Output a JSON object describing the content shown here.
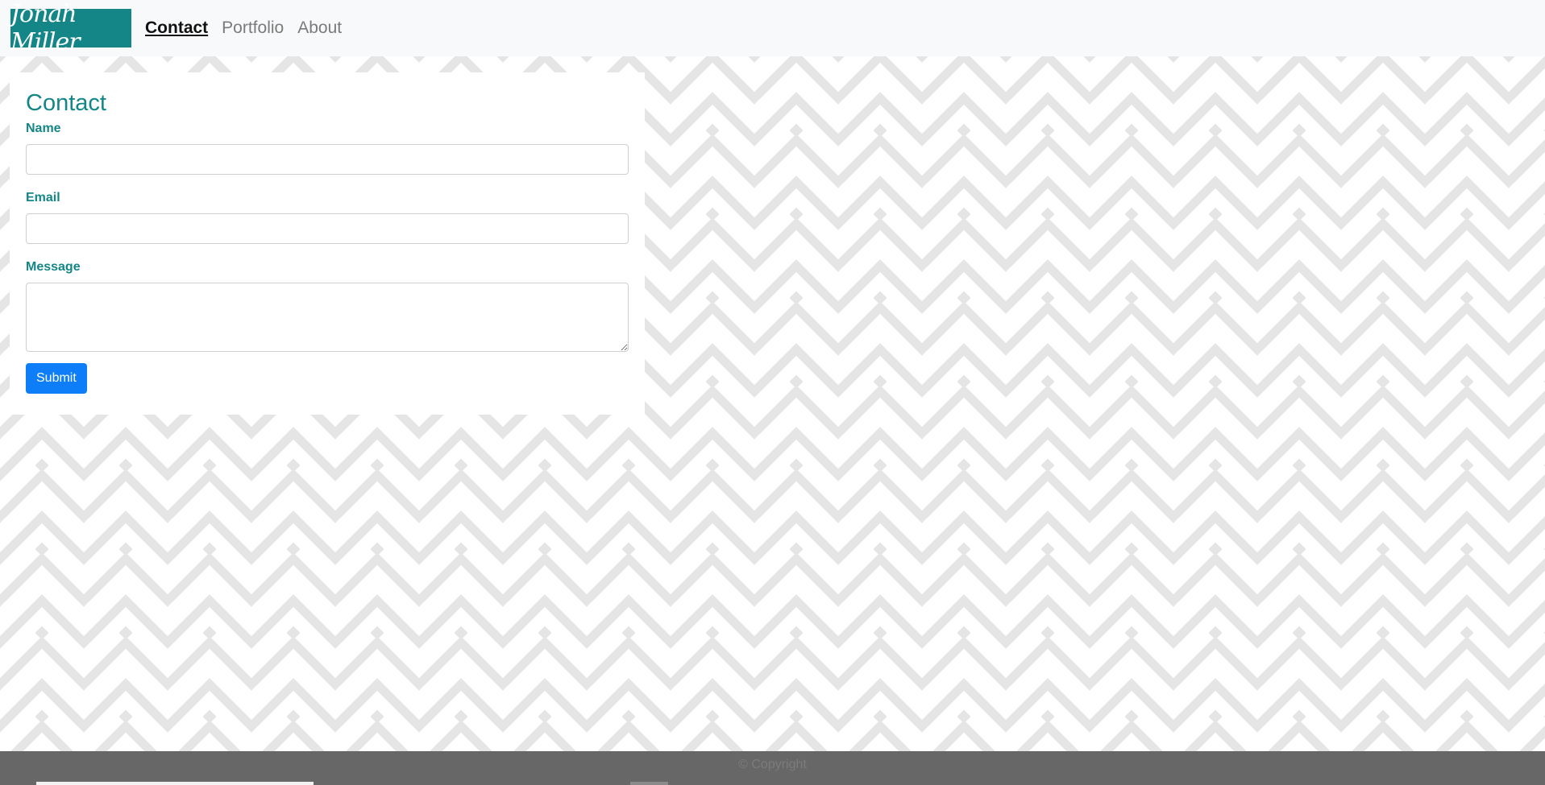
{
  "nav": {
    "brand": "Jonah Miller",
    "links": [
      "Contact",
      "Portfolio",
      "About"
    ],
    "active": "Contact"
  },
  "form": {
    "title": "Contact",
    "fields": {
      "name": {
        "label": "Name",
        "value": ""
      },
      "email": {
        "label": "Email",
        "value": ""
      },
      "message": {
        "label": "Message",
        "value": ""
      }
    },
    "submit_label": "Submit"
  },
  "footer": {
    "text": "© Copyright"
  },
  "colors": {
    "brand": "#148687",
    "nav_bg": "#f8f9fa",
    "pattern": "#e5e5e5",
    "submit": "#0d7ef8",
    "footer_bg": "#676767"
  }
}
